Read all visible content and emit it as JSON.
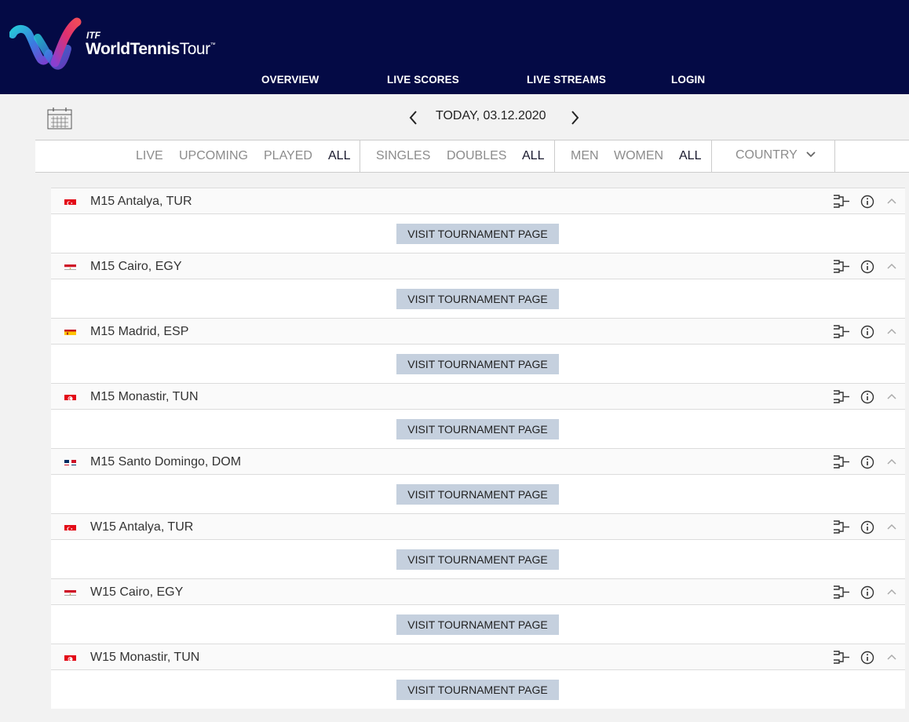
{
  "brand": {
    "itf": "ITF",
    "name_bold": "WorldTennis",
    "name_light": "Tour",
    "trademark": "™"
  },
  "nav": [
    "OVERVIEW",
    "LIVE SCORES",
    "LIVE STREAMS",
    "LOGIN"
  ],
  "date": {
    "label": "TODAY, 03.12.2020"
  },
  "filters": {
    "status": [
      "LIVE",
      "UPCOMING",
      "PLAYED",
      "ALL"
    ],
    "type": [
      "SINGLES",
      "DOUBLES",
      "ALL"
    ],
    "gender": [
      "MEN",
      "WOMEN",
      "ALL"
    ],
    "country": "COUNTRY"
  },
  "visit_label": "VISIT TOURNAMENT PAGE",
  "tournaments": [
    {
      "name": "M15 Antalya, TUR",
      "flag": "TUR"
    },
    {
      "name": "M15 Cairo, EGY",
      "flag": "EGY"
    },
    {
      "name": "M15 Madrid, ESP",
      "flag": "ESP"
    },
    {
      "name": "M15 Monastir, TUN",
      "flag": "TUN"
    },
    {
      "name": "M15 Santo Domingo, DOM",
      "flag": "DOM"
    },
    {
      "name": "W15 Antalya, TUR",
      "flag": "TUR"
    },
    {
      "name": "W15 Cairo, EGY",
      "flag": "EGY"
    },
    {
      "name": "W15 Monastir, TUN",
      "flag": "TUN"
    }
  ],
  "colors": {
    "header_bg": "#040a45",
    "button_bg": "#c5d0de",
    "turkey_red": "#e30a17",
    "egypt_red": "#ce1126",
    "spain_yellow": "#ffc400",
    "dominican_blue": "#002d62"
  }
}
